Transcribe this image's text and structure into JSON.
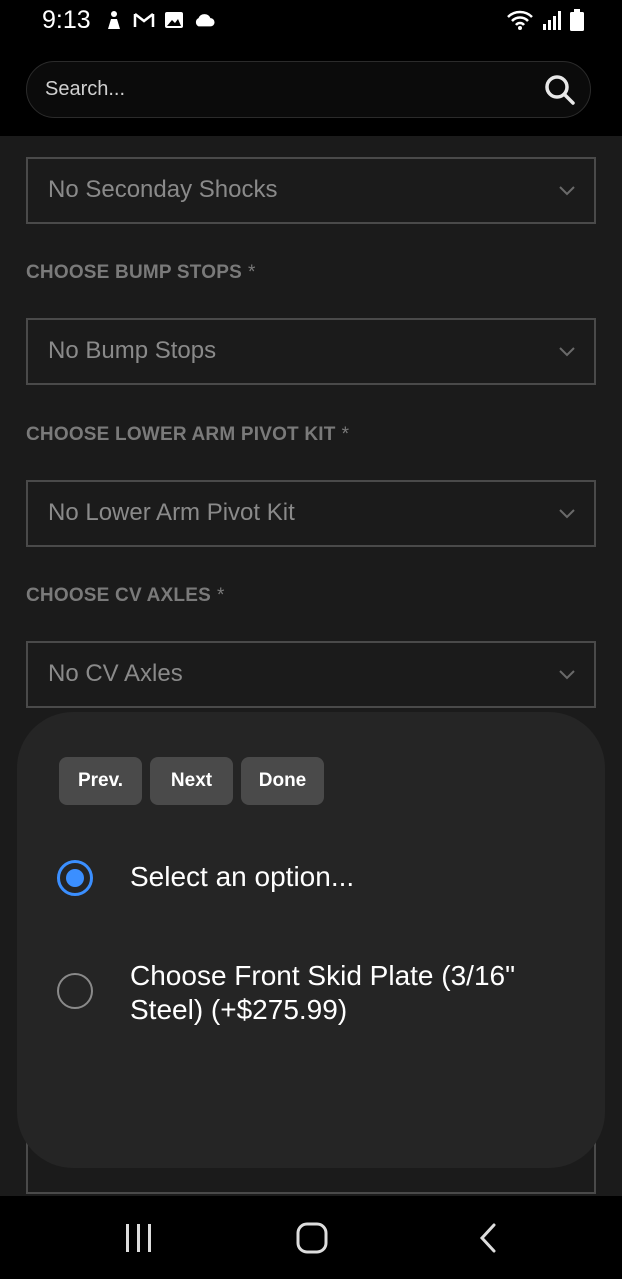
{
  "status_bar": {
    "time": "9:13",
    "left_icons": [
      "person-notification-icon",
      "gmail-icon",
      "image-icon",
      "cloud-icon"
    ],
    "right_icons": [
      "wifi-icon",
      "signal-icon",
      "battery-icon"
    ]
  },
  "search": {
    "placeholder": "Search..."
  },
  "fields": [
    {
      "label": "",
      "value": "No Seconday Shocks"
    },
    {
      "label": "CHOOSE BUMP STOPS",
      "required": "*",
      "value": "No Bump Stops"
    },
    {
      "label": "CHOOSE LOWER ARM PIVOT KIT",
      "required": "*",
      "value": "No Lower Arm Pivot Kit"
    },
    {
      "label": "CHOOSE CV AXLES",
      "required": "*",
      "value": "No CV Axles"
    }
  ],
  "sheet": {
    "buttons": [
      "Prev.",
      "Next",
      "Done"
    ],
    "options": [
      {
        "label": "Select an option...",
        "selected": true
      },
      {
        "label": "Choose Front Skid Plate (3/16\" Steel) (+$275.99)",
        "selected": false
      }
    ]
  },
  "nav_bar": {
    "buttons": [
      "recent-apps-icon",
      "home-icon",
      "back-icon"
    ]
  },
  "colors": {
    "accent": "#3b8fff",
    "background": "#1b1b1b",
    "sheet": "#252525"
  }
}
